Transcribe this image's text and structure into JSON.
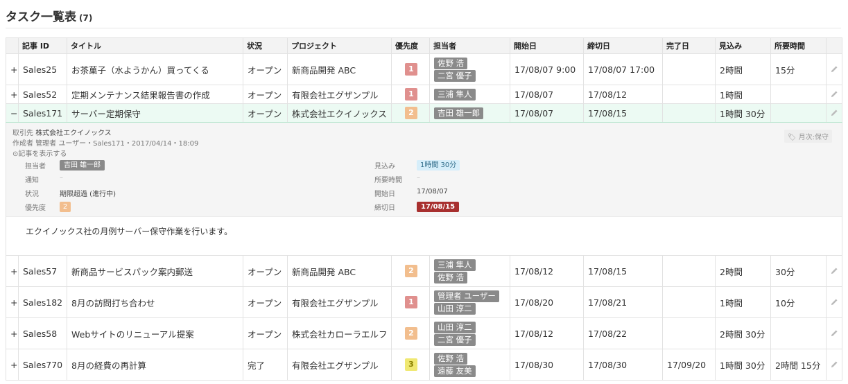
{
  "page": {
    "title": "タスク一覧表",
    "count": "(7)"
  },
  "columns": {
    "id": "記事 ID",
    "title": "タイトル",
    "status": "状況",
    "project": "プロジェクト",
    "priority": "優先度",
    "assignee": "担当者",
    "start": "開始日",
    "due": "締切日",
    "done": "完了日",
    "estimate": "見込み",
    "spent": "所要時間"
  },
  "rows": [
    {
      "expand": "+",
      "id": "Sales25",
      "title": "お茶菓子（水ようかん）買ってくる",
      "status": "オープン",
      "project": "新商品開発 ABC",
      "priority": "1",
      "assignees": [
        "佐野 浩",
        "二宮 優子"
      ],
      "start": "17/08/07 9:00",
      "due": "17/08/07 17:00",
      "done": "",
      "estimate": "2時間",
      "spent": "15分"
    },
    {
      "expand": "+",
      "id": "Sales52",
      "title": "定期メンテナンス結果報告書の作成",
      "status": "オープン",
      "project": "有限会社エグザンプル",
      "priority": "1",
      "assignees": [
        "三浦 隼人"
      ],
      "start": "17/08/07",
      "due": "17/08/12",
      "done": "",
      "estimate": "1時間",
      "spent": ""
    },
    {
      "expand": "−",
      "id": "Sales171",
      "title": "サーバー定期保守",
      "status": "オープン",
      "project": "株式会社エクイノックス",
      "priority": "2",
      "assignees": [
        "吉田 雄一郎"
      ],
      "start": "17/08/07",
      "due": "17/08/15",
      "done": "",
      "estimate": "1時間 30分",
      "spent": ""
    },
    {
      "expand": "+",
      "id": "Sales57",
      "title": "新商品サービスパック案内郵送",
      "status": "オープン",
      "project": "新商品開発 ABC",
      "priority": "2",
      "assignees": [
        "三浦 隼人",
        "佐野 浩"
      ],
      "start": "17/08/12",
      "due": "17/08/15",
      "done": "",
      "estimate": "2時間",
      "spent": "30分"
    },
    {
      "expand": "+",
      "id": "Sales182",
      "title": "8月の訪問打ち合わせ",
      "status": "オープン",
      "project": "有限会社エグザンプル",
      "priority": "1",
      "assignees": [
        "管理者 ユーザー",
        "山田 淳二"
      ],
      "start": "17/08/20",
      "due": "17/08/21",
      "done": "",
      "estimate": "1時間",
      "spent": "10分"
    },
    {
      "expand": "+",
      "id": "Sales58",
      "title": "Webサイトのリニューアル提案",
      "status": "オープン",
      "project": "株式会社カローラエルフ",
      "priority": "2",
      "assignees": [
        "山田 淳二",
        "二宮 優子"
      ],
      "start": "17/08/12",
      "due": "17/08/22",
      "done": "",
      "estimate": "2時間 30分",
      "spent": ""
    },
    {
      "expand": "+",
      "id": "Sales770",
      "title": "8月の経費の再計算",
      "status": "完了",
      "project": "有限会社エグザンプル",
      "priority": "3",
      "assignees": [
        "佐野 浩",
        "遠藤 友美"
      ],
      "start": "17/08/30",
      "due": "17/08/30",
      "done": "17/09/20",
      "estimate": "1時間 30分",
      "spent": "2時間 15分"
    }
  ],
  "detail": {
    "client_label": "取引先",
    "client": "株式会社エクイノックス",
    "meta": "作成者 管理者 ユーザー・Sales171・2017/04/14・18:09",
    "show_link": "記事を表示する",
    "tag": "月次:保守",
    "assignee_label": "担当者",
    "assignee": "吉田 雄一郎",
    "notify_label": "通知",
    "notify": "–",
    "status_label": "状況",
    "status": "期限超過 (進行中)",
    "priority_label": "優先度",
    "priority": "2",
    "estimate_label": "見込み",
    "estimate": "1時間 30分",
    "spent_label": "所要時間",
    "spent": "–",
    "start_label": "開始日",
    "start": "17/08/07",
    "due_label": "締切日",
    "due": "17/08/15",
    "description": "エクイノックス社の月例サーバー保守作業を行います。"
  }
}
